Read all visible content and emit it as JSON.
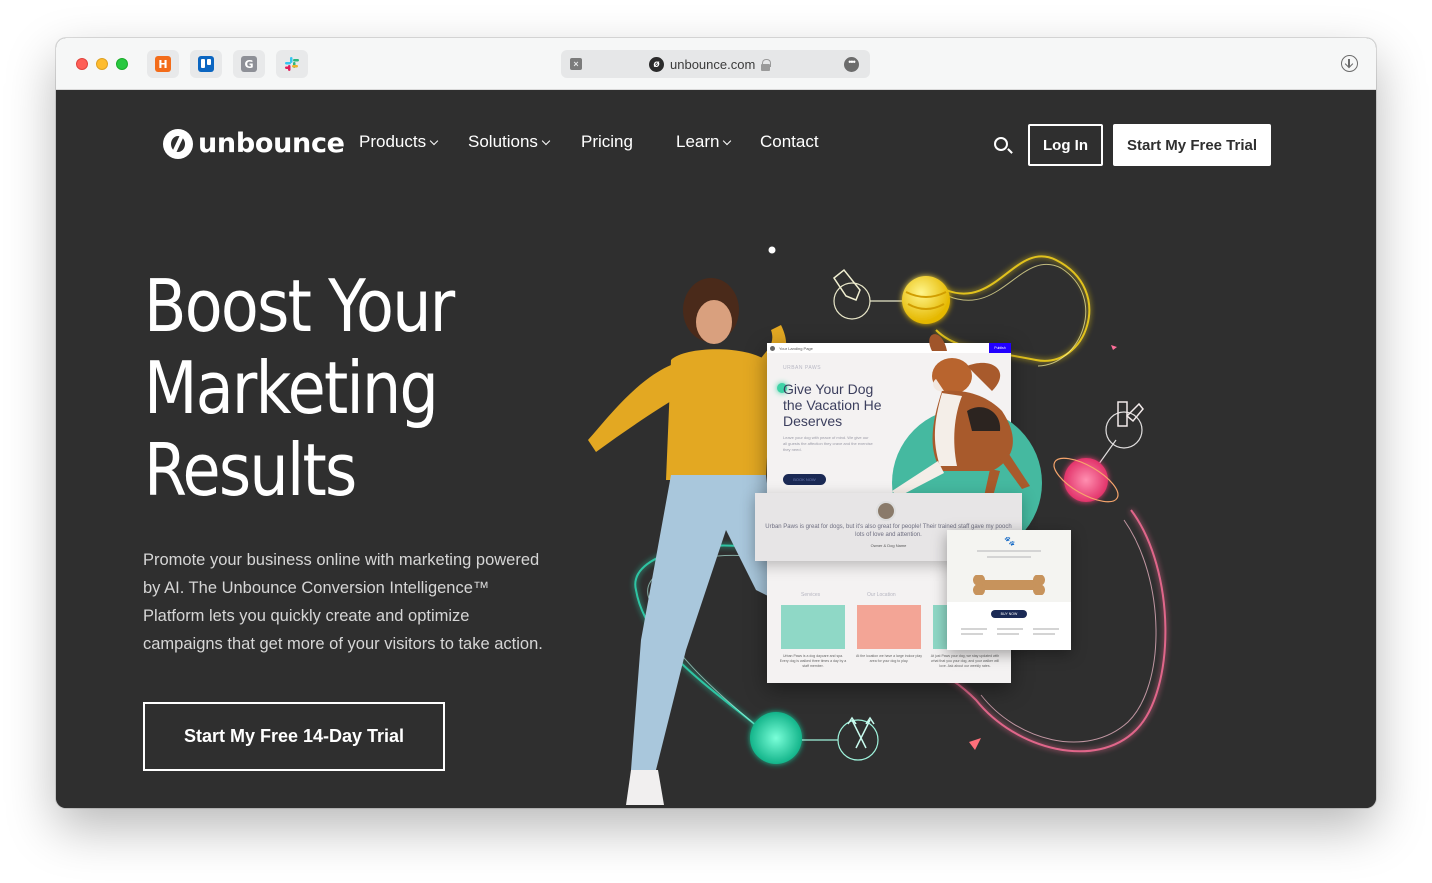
{
  "browser": {
    "tabs": [
      {
        "name": "harvest",
        "glyph": "H",
        "color": "#f36c1a"
      },
      {
        "name": "trello",
        "glyph": "",
        "color": "#0c66c1"
      },
      {
        "name": "grammarly",
        "glyph": "G",
        "color": "#8e9097"
      },
      {
        "name": "slack",
        "glyph": "",
        "color": "#e8e9ea"
      }
    ],
    "url": "unbounce.com",
    "more_label": "•••"
  },
  "nav": {
    "brand": "unbounce",
    "items": [
      {
        "label": "Products",
        "has_dropdown": true
      },
      {
        "label": "Solutions",
        "has_dropdown": true
      },
      {
        "label": "Pricing",
        "has_dropdown": false
      },
      {
        "label": "Learn",
        "has_dropdown": true
      },
      {
        "label": "Contact",
        "has_dropdown": false
      }
    ],
    "login": "Log In",
    "trial": "Start My Free Trial"
  },
  "hero": {
    "title_lines": [
      "Boost Your",
      "Marketing",
      "Results"
    ],
    "body": "Promote your business online with marketing powered by AI. The Unbounce Conversion Intelligence™ Platform lets you quickly create and optimize campaigns that get more of your visitors to take action.",
    "cta": "Start My Free 14-Day Trial"
  },
  "illustration": {
    "landing_page": {
      "bar_title": "Your Landing Page",
      "publish": "Publish",
      "brand": "URBAN PAWS",
      "headline": "Give Your Dog the Vacation He Deserves",
      "subtext": "Leave your dog with peace of mind. We give our all guests the affection they crave and the exercise they need.",
      "book_now": "BOOK NOW",
      "testimonial": "Urban Paws is great for dogs, but it's also great for people! Their trained staff gave my pooch lots of love and attention.",
      "testimonial_author": "Owner & Dog Name",
      "sections": [
        "Services",
        "Our Location"
      ],
      "cards": [
        "Urban Paws is a dog daycare and spa. Every dog is walked three times a day by a staff member.",
        "At the location we have a large indoor play area for your dog to play.",
        "At just Paws your dog, we stay updated with what that you your dog, and your walker will love. Ask about our weekly rates."
      ]
    },
    "product_card": {
      "buy_now": "BUY NOW"
    }
  },
  "colors": {
    "page_bg": "#2f2f2f",
    "accent_teal": "#45b9a0",
    "glow_yellow": "#f5d31a",
    "glow_pink": "#ff5f8f",
    "navy": "#1b2a55"
  }
}
